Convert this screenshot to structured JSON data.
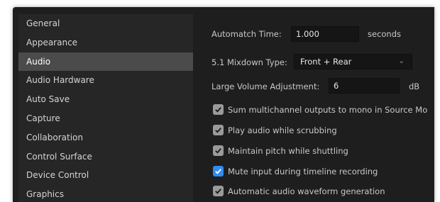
{
  "sidebar": {
    "items": [
      {
        "label": "General"
      },
      {
        "label": "Appearance"
      },
      {
        "label": "Audio"
      },
      {
        "label": "Audio Hardware"
      },
      {
        "label": "Auto Save"
      },
      {
        "label": "Capture"
      },
      {
        "label": "Collaboration"
      },
      {
        "label": "Control Surface"
      },
      {
        "label": "Device Control"
      },
      {
        "label": "Graphics"
      }
    ],
    "selected_label": "Audio"
  },
  "audio": {
    "automatch": {
      "label": "Automatch Time:",
      "value": "1.000",
      "unit": "seconds"
    },
    "mixdown": {
      "label": "5.1 Mixdown Type:",
      "value": "Front + Rear"
    },
    "volume": {
      "label": "Large Volume Adjustment:",
      "value": "6",
      "unit": "dB"
    },
    "options": [
      {
        "label": "Sum multichannel outputs to mono in Source Mo",
        "checked": true,
        "style": "gray"
      },
      {
        "label": "Play audio while scrubbing",
        "checked": true,
        "style": "gray"
      },
      {
        "label": "Maintain pitch while shuttling",
        "checked": true,
        "style": "gray"
      },
      {
        "label": "Mute input during timeline recording",
        "checked": true,
        "style": "blue"
      },
      {
        "label": "Automatic audio waveform generation",
        "checked": true,
        "style": "gray"
      }
    ]
  },
  "colors": {
    "accent": "#2f8cf2",
    "checkbox_gray": "#9a9a9a",
    "selected_row": "#4b4b4b",
    "panel": "#1e1e1e",
    "sidebar": "#262626"
  }
}
